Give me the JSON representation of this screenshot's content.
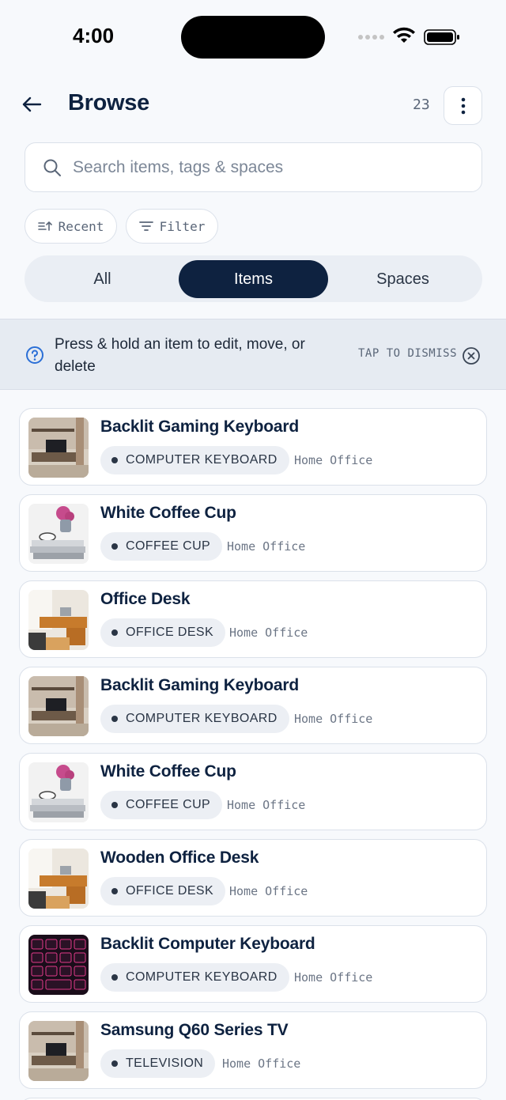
{
  "status": {
    "time": "4:00"
  },
  "header": {
    "title": "Browse",
    "count": "23"
  },
  "search": {
    "placeholder": "Search items, tags & spaces"
  },
  "chips": {
    "sort_label": "Recent",
    "filter_label": "Filter"
  },
  "tabs": [
    {
      "label": "All",
      "active": false
    },
    {
      "label": "Items",
      "active": true
    },
    {
      "label": "Spaces",
      "active": false
    }
  ],
  "hint": {
    "text": "Press & hold an item to edit, move, or delete",
    "dismiss": "TAP TO DISMISS"
  },
  "colors": {
    "primary": "#0e2240",
    "background": "#f7f9fc",
    "banner": "#e6ebf2",
    "tag_bg": "#eceff4"
  },
  "items": [
    {
      "title": "Backlit Gaming Keyboard",
      "tag": "COMPUTER KEYBOARD",
      "location": "Home Office",
      "thumb": "living-room-tv"
    },
    {
      "title": "White Coffee Cup",
      "tag": "COFFEE CUP",
      "location": "Home Office",
      "thumb": "coffee-cup-flowers"
    },
    {
      "title": "Office Desk",
      "tag": "OFFICE DESK",
      "location": "Home Office",
      "thumb": "office-desk"
    },
    {
      "title": "Backlit Gaming Keyboard",
      "tag": "COMPUTER KEYBOARD",
      "location": "Home Office",
      "thumb": "living-room-tv"
    },
    {
      "title": "White Coffee Cup",
      "tag": "COFFEE CUP",
      "location": "Home Office",
      "thumb": "coffee-cup-flowers"
    },
    {
      "title": "Wooden Office Desk",
      "tag": "OFFICE DESK",
      "location": "Home Office",
      "thumb": "office-desk"
    },
    {
      "title": "Backlit Computer Keyboard",
      "tag": "COMPUTER KEYBOARD",
      "location": "Home Office",
      "thumb": "rgb-keyboard"
    },
    {
      "title": "Samsung Q60 Series TV",
      "tag": "TELEVISION",
      "location": "Home Office",
      "thumb": "living-room-tv"
    }
  ]
}
